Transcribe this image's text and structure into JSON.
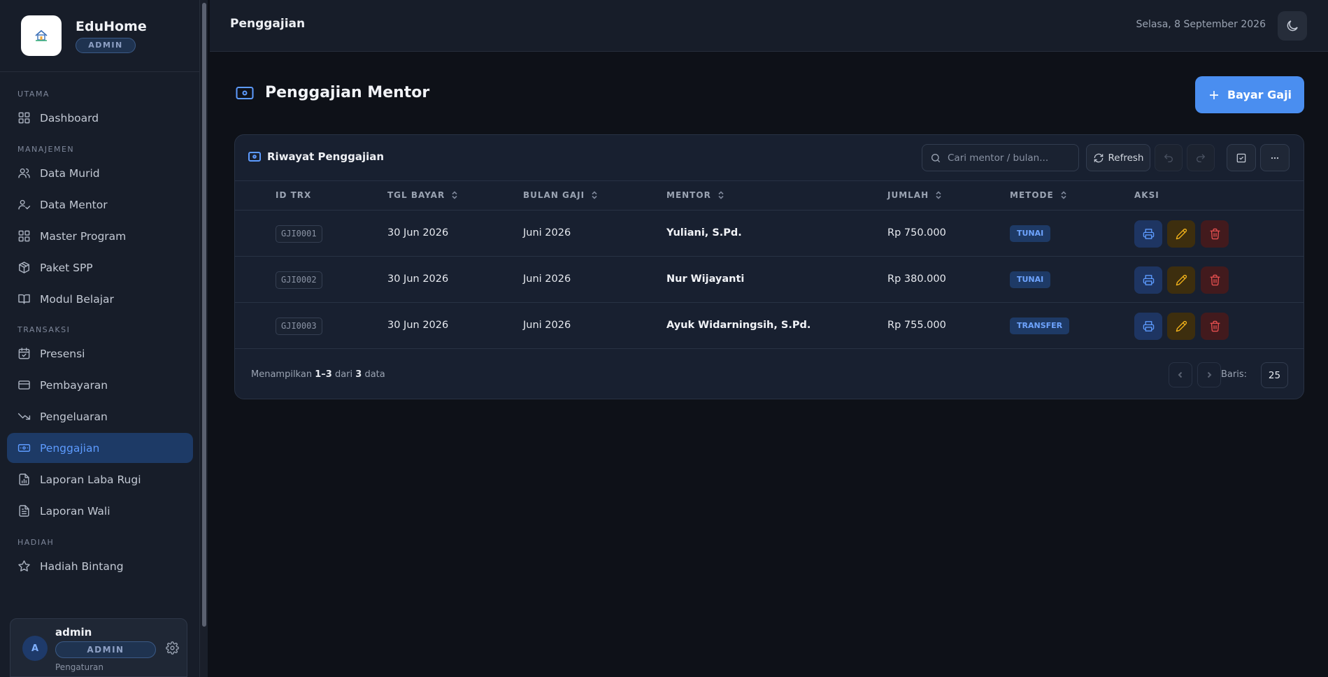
{
  "brand": {
    "name": "EduHome",
    "role": "ADMIN"
  },
  "sidebar": {
    "sections": [
      {
        "label": "UTAMA",
        "items": [
          {
            "label": "Dashboard",
            "icon": "grid-icon"
          }
        ]
      },
      {
        "label": "MANAJEMEN",
        "items": [
          {
            "label": "Data Murid",
            "icon": "users-icon"
          },
          {
            "label": "Data Mentor",
            "icon": "user-check-icon"
          },
          {
            "label": "Master Program",
            "icon": "grid-icon"
          },
          {
            "label": "Paket SPP",
            "icon": "package-icon"
          },
          {
            "label": "Modul Belajar",
            "icon": "book-icon"
          }
        ]
      },
      {
        "label": "TRANSAKSI",
        "items": [
          {
            "label": "Presensi",
            "icon": "calendar-check-icon"
          },
          {
            "label": "Pembayaran",
            "icon": "credit-card-icon"
          },
          {
            "label": "Pengeluaran",
            "icon": "trending-down-icon"
          },
          {
            "label": "Penggajian",
            "icon": "banknote-icon",
            "active": true
          },
          {
            "label": "Laporan Laba Rugi",
            "icon": "file-chart-icon"
          },
          {
            "label": "Laporan Wali",
            "icon": "file-text-icon"
          }
        ]
      },
      {
        "label": "HADIAH",
        "items": [
          {
            "label": "Hadiah Bintang",
            "icon": "star-icon"
          }
        ]
      }
    ]
  },
  "user": {
    "initial": "A",
    "name": "admin",
    "role": "ADMIN",
    "settings": "Pengaturan"
  },
  "header": {
    "title": "Penggajian",
    "date": "Selasa, 8 September 2026"
  },
  "page": {
    "title": "Penggajian Mentor",
    "pay_button": "Bayar Gaji"
  },
  "card": {
    "title": "Riwayat Penggajian",
    "search_placeholder": "Cari mentor / bulan...",
    "refresh_label": "Refresh"
  },
  "table": {
    "columns": [
      "ID TRX",
      "TGL BAYAR",
      "BULAN GAJI",
      "MENTOR",
      "JUMLAH",
      "METODE",
      "AKSI"
    ],
    "rows": [
      {
        "id": "GJI0001",
        "tgl_bayar": "30 Jun 2026",
        "bulan_gaji": "Juni 2026",
        "mentor": "Yuliani, S.Pd.",
        "jumlah": "Rp 750.000",
        "metode": "TUNAI"
      },
      {
        "id": "GJI0002",
        "tgl_bayar": "30 Jun 2026",
        "bulan_gaji": "Juni 2026",
        "mentor": "Nur Wijayanti",
        "jumlah": "Rp 380.000",
        "metode": "TUNAI"
      },
      {
        "id": "GJI0003",
        "tgl_bayar": "30 Jun 2026",
        "bulan_gaji": "Juni 2026",
        "mentor": "Ayuk Widarningsih, S.Pd.",
        "jumlah": "Rp 755.000",
        "metode": "TRANSFER"
      }
    ]
  },
  "footer": {
    "prefix": "Menampilkan",
    "range": "1–3",
    "middle": "dari",
    "total": "3",
    "suffix": "data",
    "rows_label": "Baris:",
    "rows_value": "25"
  },
  "colors": {
    "accent": "#4a8ef0",
    "active_nav_bg": "#1d3a66",
    "edit": "#f4b41a",
    "delete": "#e85050"
  }
}
